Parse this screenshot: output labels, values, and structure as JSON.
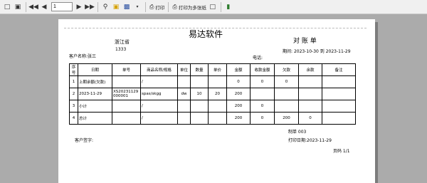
{
  "toolbar": {
    "page_value": "1",
    "print_label": "打印",
    "print_multi_label": "打印为多张纸"
  },
  "report": {
    "company": "易达软件",
    "title": "对 账 单",
    "province": "浙江省",
    "code": "1333",
    "customer_label": "客户名称:",
    "customer_name": "张三",
    "phone_label": "电话:",
    "period_label": "期间:",
    "period_from": "2023-10-30",
    "period_to_label": "到",
    "period_to": "2023-11-29",
    "maker": "制单 003",
    "customer_sign": "客户签字:",
    "print_date": "打印日期:2023-11-29",
    "page_label": "页码 1/1"
  },
  "table": {
    "headers": [
      "序号",
      "日期",
      "单号",
      "商品名称/规格",
      "单位",
      "数量",
      "单价",
      "金额",
      "收款金额",
      "欠款",
      "余款",
      "备注"
    ],
    "rows": [
      [
        "1",
        "上期余额(欠款)",
        "",
        "/",
        "",
        "",
        "",
        "0",
        "0",
        "0",
        "",
        ""
      ],
      [
        "2",
        "2023-11-29",
        "XS20231129000001",
        "spas/skgg",
        "dw",
        "10",
        "20",
        "200",
        "",
        "",
        "",
        ""
      ],
      [
        "3",
        "小计",
        "",
        "/",
        "",
        "",
        "",
        "200",
        "0",
        "",
        "",
        ""
      ],
      [
        "4",
        "总计",
        "",
        "/",
        "",
        "",
        "",
        "200",
        "0",
        "200",
        "0",
        ""
      ]
    ]
  }
}
